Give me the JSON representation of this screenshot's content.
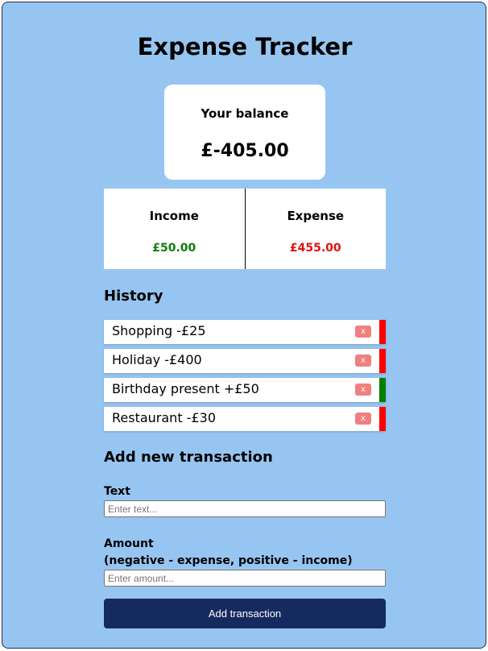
{
  "app": {
    "title": "Expense Tracker"
  },
  "balance": {
    "label": "Your balance",
    "value": "£-405.00"
  },
  "summary": {
    "income_label": "Income",
    "income_value": "£50.00",
    "expense_label": "Expense",
    "expense_value": "£455.00"
  },
  "history": {
    "heading": "History",
    "items": [
      {
        "text": "Shopping -£25",
        "delete_label": "x",
        "kind": "expense"
      },
      {
        "text": "Holiday -£400",
        "delete_label": "x",
        "kind": "expense"
      },
      {
        "text": "Birthday present +£50",
        "delete_label": "x",
        "kind": "income"
      },
      {
        "text": "Restaurant -£30",
        "delete_label": "x",
        "kind": "expense"
      }
    ]
  },
  "form": {
    "heading": "Add new transaction",
    "text_label": "Text",
    "text_placeholder": "Enter text...",
    "amount_label_line1": "Amount",
    "amount_label_line2": "(negative - expense, positive - income)",
    "amount_placeholder": "Enter amount...",
    "submit_label": "Add transaction"
  },
  "colors": {
    "background": "#97c5f1",
    "income": "#0a7f0a",
    "expense": "#e01010",
    "button": "#152a5e",
    "delete": "#f08080"
  },
  "icons": {
    "delete": "close-icon"
  }
}
